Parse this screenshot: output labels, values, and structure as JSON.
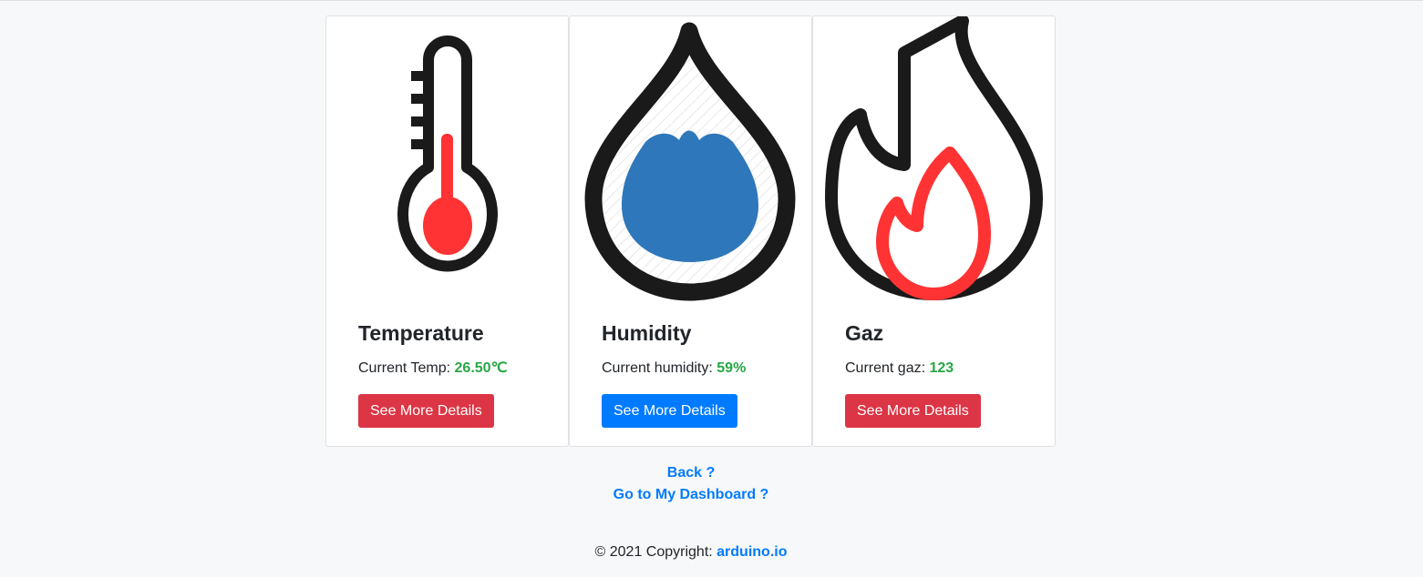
{
  "cards": [
    {
      "title": "Temperature",
      "text_label": "Current Temp: ",
      "reading": "26.50℃",
      "button_label": "See More Details",
      "icon": "thermometer-icon",
      "button_color": "#dc3545"
    },
    {
      "title": "Humidity",
      "text_label": "Current humidity: ",
      "reading": "59%",
      "button_label": "See More Details",
      "icon": "water-drop-icon",
      "button_color": "#007bff"
    },
    {
      "title": "Gaz",
      "text_label": "Current gaz: ",
      "reading": "123",
      "button_label": "See More Details",
      "icon": "flame-icon",
      "button_color": "#dc3545"
    }
  ],
  "links": {
    "back": "Back ?",
    "dashboard": "Go to My Dashboard ?"
  },
  "footer": {
    "copyright": "© 2021 Copyright: ",
    "site": "arduino.io"
  },
  "colors": {
    "reading": "#28a745",
    "link": "#007bff",
    "icon_red": "#ff3333",
    "icon_blue": "#2e77ba",
    "icon_outline": "#1a1a1a"
  }
}
